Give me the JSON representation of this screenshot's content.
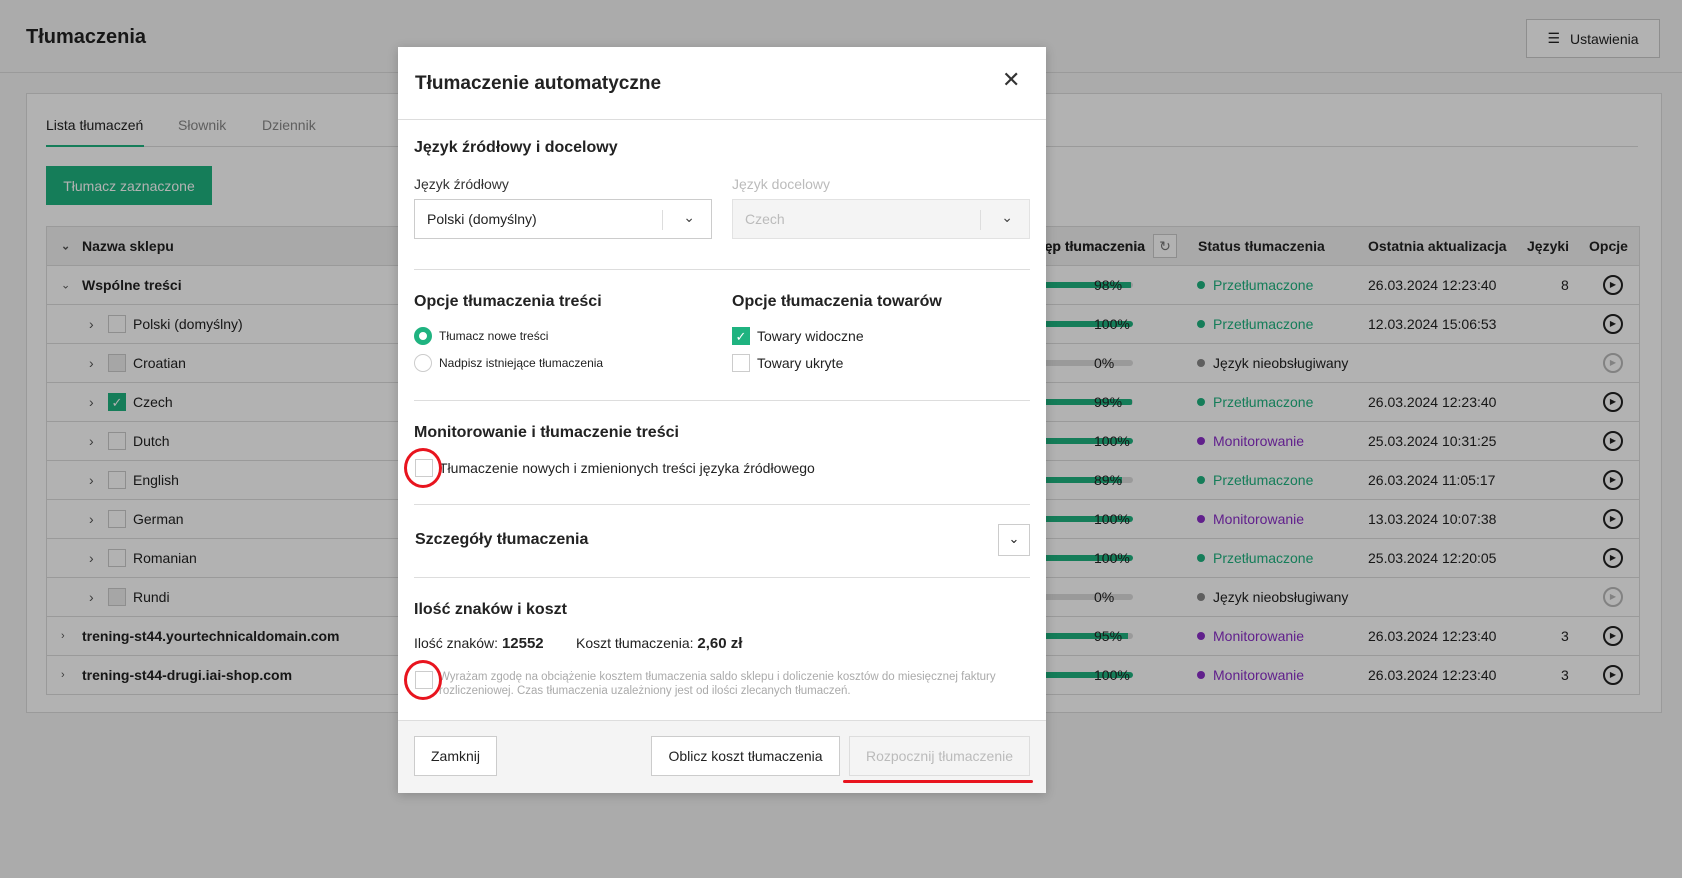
{
  "header": {
    "title": "Tłumaczenia",
    "settings_label": "Ustawienia",
    "settings_icon": "sliders-icon"
  },
  "tabs": [
    {
      "label": "Lista tłumaczeń",
      "active": true
    },
    {
      "label": "Słownik"
    },
    {
      "label": "Dziennik"
    }
  ],
  "translate_selected_label": "Tłumacz zaznaczone",
  "colors": {
    "accent": "#1fb380",
    "monitoring": "#8b2fc9",
    "unsupported": "#888888",
    "annotation": "#e8141e"
  },
  "table": {
    "columns": [
      "Nazwa sklepu",
      "Postęp tłumaczenia",
      "Status tłumaczenia",
      "Ostatnia aktualizacja",
      "Języki",
      "Opcje"
    ],
    "column_progress_visible": "ęp tłumaczenia",
    "rows": [
      {
        "name": "Wspólne treści",
        "level": 0,
        "expanded": true,
        "progress": 98,
        "progress_label": "98%",
        "status": "Przetłumaczone",
        "status_type": "ok",
        "date": "26.03.2024 12:23:40",
        "langs": "8"
      },
      {
        "name": "Polski (domyślny)",
        "level": 1,
        "checkbox": "off",
        "progress": 100,
        "progress_label": "100%",
        "status": "Przetłumaczone",
        "status_type": "ok",
        "date": "12.03.2024 15:06:53",
        "langs": ""
      },
      {
        "name": "Croatian",
        "level": 1,
        "checkbox": "disabled",
        "progress": 0,
        "progress_label": "0%",
        "status": "Język nieobsługiwany",
        "status_type": "unsupported",
        "date": "",
        "langs": ""
      },
      {
        "name": "Czech",
        "level": 1,
        "checkbox": "on",
        "progress": 99,
        "progress_label": "99%",
        "status": "Przetłumaczone",
        "status_type": "ok",
        "date": "26.03.2024 12:23:40",
        "langs": ""
      },
      {
        "name": "Dutch",
        "level": 1,
        "checkbox": "off",
        "progress": 100,
        "progress_label": "100%",
        "status": "Monitorowanie",
        "status_type": "monitor",
        "date": "25.03.2024 10:31:25",
        "langs": ""
      },
      {
        "name": "English",
        "level": 1,
        "checkbox": "off",
        "progress": 89,
        "progress_label": "89%",
        "status": "Przetłumaczone",
        "status_type": "ok",
        "date": "26.03.2024 11:05:17",
        "langs": ""
      },
      {
        "name": "German",
        "level": 1,
        "checkbox": "off",
        "progress": 100,
        "progress_label": "100%",
        "status": "Monitorowanie",
        "status_type": "monitor",
        "date": "13.03.2024 10:07:38",
        "langs": ""
      },
      {
        "name": "Romanian",
        "level": 1,
        "checkbox": "off",
        "progress": 100,
        "progress_label": "100%",
        "status": "Przetłumaczone",
        "status_type": "ok",
        "date": "25.03.2024 12:20:05",
        "langs": ""
      },
      {
        "name": "Rundi",
        "level": 1,
        "checkbox": "disabled",
        "progress": 0,
        "progress_label": "0%",
        "status": "Język nieobsługiwany",
        "status_type": "unsupported",
        "date": "",
        "langs": ""
      },
      {
        "name": "trening-st44.yourtechnicaldomain.com",
        "level": 0,
        "expanded": false,
        "progress": 95,
        "progress_label": "95%",
        "status": "Monitorowanie",
        "status_type": "monitor",
        "date": "26.03.2024 12:23:40",
        "langs": "3"
      },
      {
        "name": "trening-st44-drugi.iai-shop.com",
        "level": 0,
        "expanded": false,
        "progress": 100,
        "progress_label": "100%",
        "status": "Monitorowanie",
        "status_type": "monitor",
        "date": "26.03.2024 12:23:40",
        "langs": "3"
      }
    ]
  },
  "modal": {
    "title": "Tłumaczenie automatyczne",
    "lang_section": "Język źródłowy i docelowy",
    "source_label": "Język źródłowy",
    "source_value": "Polski (domyślny)",
    "target_label": "Język docelowy",
    "target_value": "Czech",
    "content_options_title": "Opcje tłumaczenia treści",
    "content_options": [
      {
        "label": "Tłumacz nowe treści",
        "selected": true
      },
      {
        "label": "Nadpisz istniejące tłumaczenia",
        "selected": false
      }
    ],
    "product_options_title": "Opcje tłumaczenia towarów",
    "product_options": [
      {
        "label": "Towary widoczne",
        "checked": true
      },
      {
        "label": "Towary ukryte",
        "checked": false
      }
    ],
    "monitor_title": "Monitorowanie i tłumaczenie treści",
    "monitor_label": "Tłumaczenie nowych i zmienionych treści języka źródłowego",
    "details_title": "Szczegóły tłumaczenia",
    "cost_title": "Ilość znaków i koszt",
    "chars_label": "Ilość znaków:",
    "chars_value": "12552",
    "cost_label": "Koszt tłumaczenia:",
    "cost_value": "2,60 zł",
    "consent_text": "Wyrażam zgodę na obciążenie kosztem tłumaczenia saldo sklepu i doliczenie kosztów do miesięcznej faktury rozliczeniowej. Czas tłumaczenia uzależniony jest od ilości zlecanych tłumaczeń.",
    "close_label": "Zamknij",
    "calc_label": "Oblicz koszt tłumaczenia",
    "start_label": "Rozpocznij tłumaczenie"
  }
}
